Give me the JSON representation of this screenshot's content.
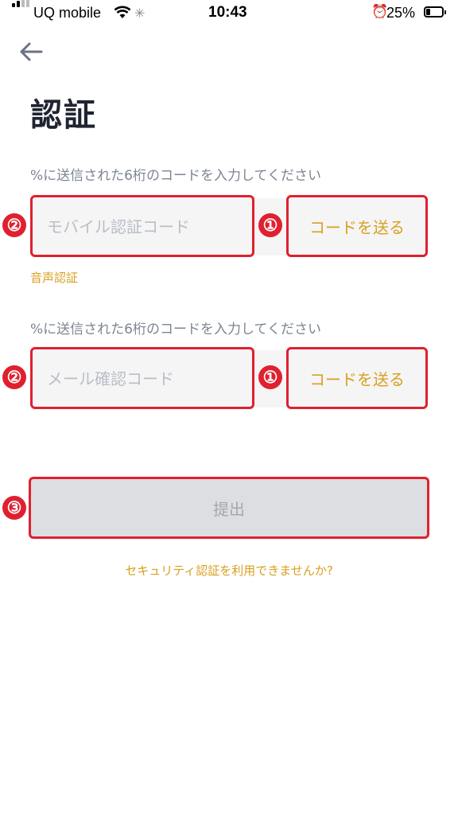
{
  "status_bar": {
    "carrier": "UQ mobile",
    "time": "10:43",
    "battery_percent": "25%",
    "battery_level": 0.25,
    "signal_icon": "signal-bars-icon",
    "wifi_icon": "wifi-icon",
    "loading_icon": "activity-spinner-icon",
    "alarm_icon": "alarm-clock-icon",
    "battery_icon": "battery-icon"
  },
  "header": {
    "back_icon": "arrow-left-icon",
    "title": "認証"
  },
  "mobile_section": {
    "hint": "%に送信された6桁のコードを入力してください",
    "input_placeholder": "モバイル認証コード",
    "input_value": "",
    "send_label": "コードを送る",
    "voice_link": "音声認証",
    "input_badge": "②",
    "send_badge": "①"
  },
  "email_section": {
    "hint": "%に送信された6桁のコードを入力してください",
    "input_placeholder": "メール確認コード",
    "input_value": "",
    "send_label": "コードを送る",
    "input_badge": "②",
    "send_badge": "①"
  },
  "submit": {
    "label": "提出",
    "badge": "③"
  },
  "help_link": "セキュリティ認証を利用できませんか?",
  "colors": {
    "accent": "#d9a021",
    "highlight": "#e0202f",
    "title": "#1f2430",
    "muted_text": "#7d8592",
    "field_bg": "#f5f5f5",
    "button_disabled": "#dcdee2"
  }
}
